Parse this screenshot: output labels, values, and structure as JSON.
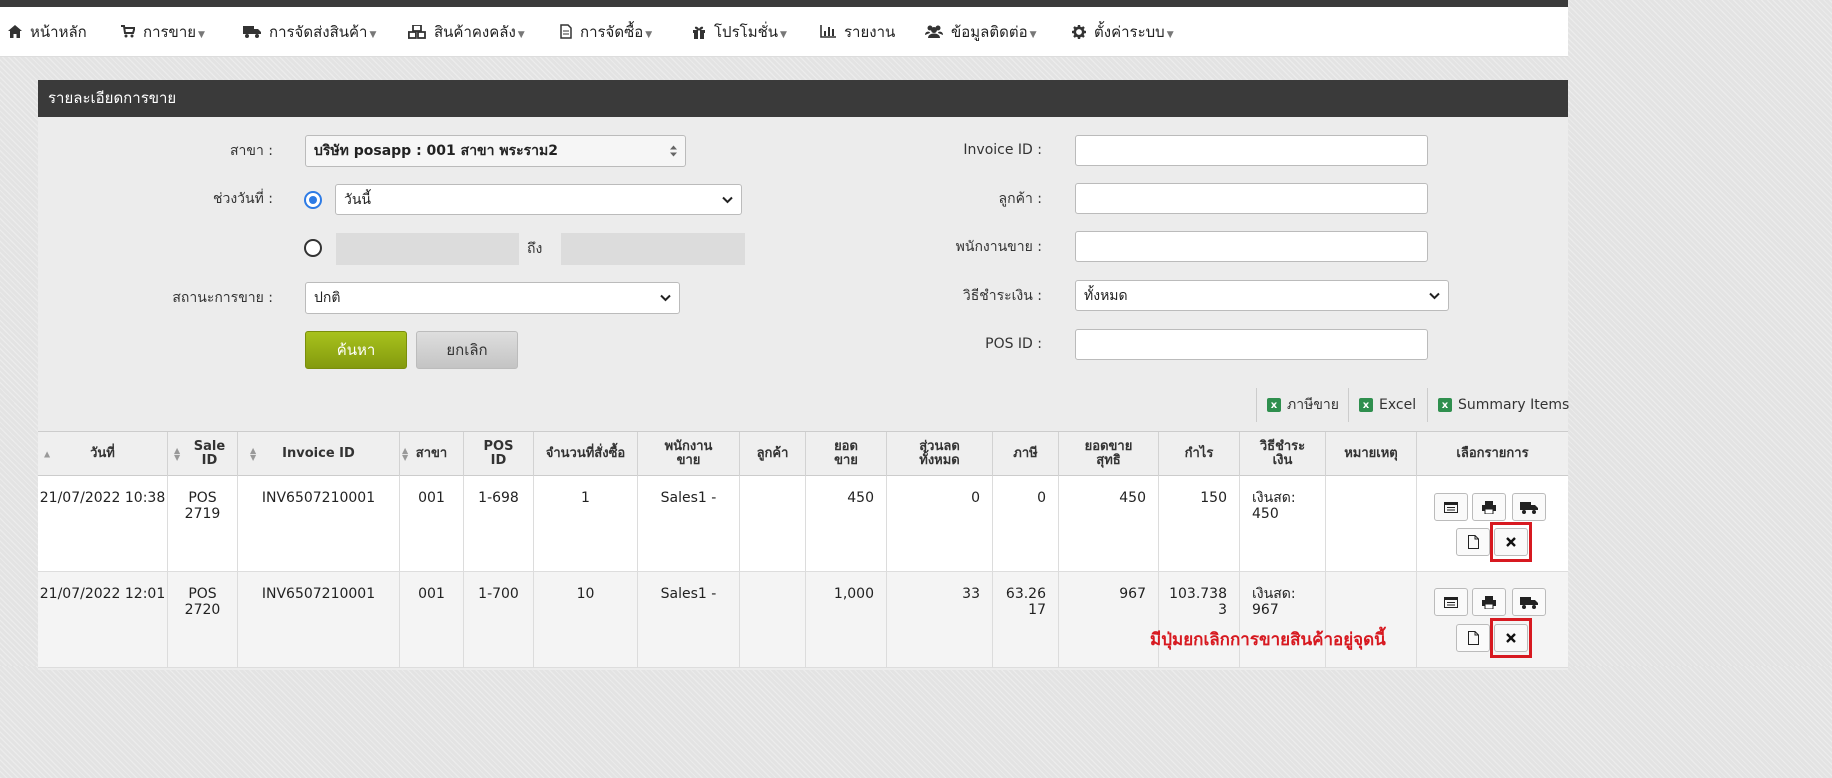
{
  "colors": {
    "accent": "#2d7be5",
    "search_button": "#97b115",
    "highlight": "#d71920",
    "panel_header": "#3a3a3a"
  },
  "nav": {
    "items": [
      {
        "label": "หน้าหลัก",
        "icon": "home-icon",
        "dropdown": false
      },
      {
        "label": "การขาย",
        "icon": "cart-icon",
        "dropdown": true
      },
      {
        "label": "การจัดส่งสินค้า",
        "icon": "truck-icon",
        "dropdown": true
      },
      {
        "label": "สินค้าคงคลัง",
        "icon": "cubes-icon",
        "dropdown": true
      },
      {
        "label": "การจัดซื้อ",
        "icon": "document-icon",
        "dropdown": true
      },
      {
        "label": "โปรโมชั่น",
        "icon": "gift-icon",
        "dropdown": true
      },
      {
        "label": "รายงาน",
        "icon": "bar-chart-icon",
        "dropdown": false
      },
      {
        "label": "ข้อมูลติดต่อ",
        "icon": "users-icon",
        "dropdown": true
      },
      {
        "label": "ตั้งค่าระบบ",
        "icon": "gear-icon",
        "dropdown": true
      }
    ]
  },
  "panel": {
    "title": "รายละเอียดการขาย"
  },
  "form": {
    "branch_label": "สาขา :",
    "branch_value": "บริษัท posapp : 001 สาขา พระราม2",
    "daterange_label": "ช่วงวันที่ :",
    "daterange_value": "วันนี้",
    "daterange_to": "ถึง",
    "status_label": "สถานะการขาย :",
    "status_value": "ปกติ",
    "search_button": "ค้นหา",
    "cancel_button": "ยกเลิก",
    "invoice_label": "Invoice ID :",
    "customer_label": "ลูกค้า :",
    "salesperson_label": "พนักงานขาย :",
    "payment_label": "วิธีชำระเงิน :",
    "payment_value": "ทั้งหมด",
    "posid_label": "POS ID :"
  },
  "exports": {
    "tax": "ภาษีขาย",
    "excel": "Excel",
    "summary": "Summary Items",
    "icon": "excel-icon"
  },
  "table": {
    "columns": [
      "วันที่",
      "Sale ID",
      "Invoice ID",
      "สาขา",
      "POS ID",
      "จำนวนที่สั่งซื้อ",
      "พนักงานขาย",
      "ลูกค้า",
      "ยอดขาย",
      "ส่วนลดทั้งหมด",
      "ภาษี",
      "ยอดขายสุทธิ",
      "กำไร",
      "วิธีชำระเงิน",
      "หมายเหตุ",
      "เลือกรายการ"
    ],
    "rows": [
      {
        "date": "21/07/2022 10:38",
        "sale_id": "POS 2719",
        "invoice_id": "INV6507210001",
        "branch": "001",
        "pos_id": "1-698",
        "qty": "1",
        "salesperson": "Sales1 -",
        "customer": "",
        "sales": "450",
        "discount": "0",
        "tax": "0",
        "net": "450",
        "profit": "150",
        "payment": "เงินสด: 450",
        "note": ""
      },
      {
        "date": "21/07/2022 12:01",
        "sale_id": "POS 2720",
        "invoice_id": "INV6507210001",
        "branch": "001",
        "pos_id": "1-700",
        "qty": "10",
        "salesperson": "Sales1 -",
        "customer": "",
        "sales": "1,000",
        "discount": "33",
        "tax": "63.2617",
        "net": "967",
        "profit": "103.7383",
        "payment": "เงินสด: 967",
        "note": ""
      }
    ]
  },
  "annotation": "มีปุ่มยกเลิกการขายสินค้าอยู่จุดนี้"
}
